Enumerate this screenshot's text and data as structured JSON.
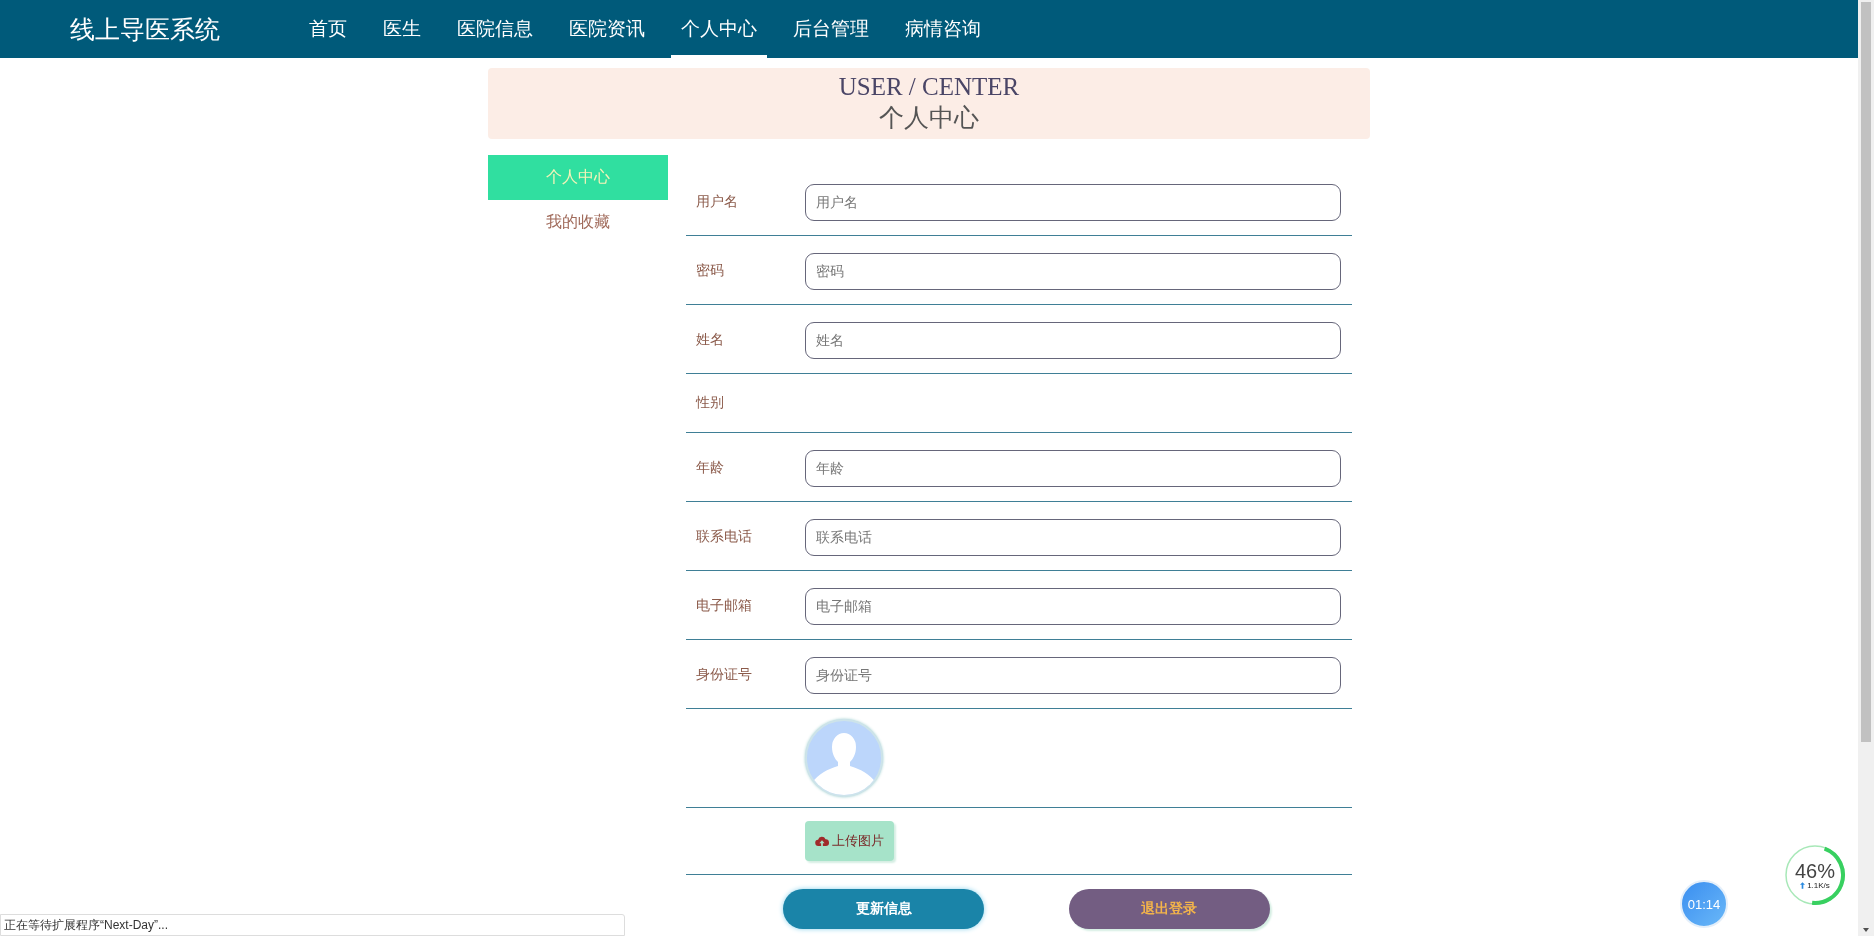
{
  "header": {
    "logo": "线上导医系统",
    "nav": [
      {
        "label": "首页",
        "selected": false
      },
      {
        "label": "医生",
        "selected": false
      },
      {
        "label": "医院信息",
        "selected": false
      },
      {
        "label": "医院资讯",
        "selected": false
      },
      {
        "label": "个人中心",
        "selected": true
      },
      {
        "label": "后台管理",
        "selected": false
      },
      {
        "label": "病情咨询",
        "selected": false
      }
    ]
  },
  "banner": {
    "title": "USER / CENTER",
    "subtitle": "个人中心"
  },
  "sidebar": {
    "items": [
      {
        "label": "个人中心",
        "selected": true
      },
      {
        "label": "我的收藏",
        "selected": false
      }
    ]
  },
  "form": {
    "rows": [
      {
        "kind": "input",
        "label": "用户名",
        "placeholder": "用户名"
      },
      {
        "kind": "input",
        "label": "密码",
        "placeholder": "密码"
      },
      {
        "kind": "input",
        "label": "姓名",
        "placeholder": "姓名"
      },
      {
        "kind": "blank",
        "label": "性别"
      },
      {
        "kind": "input",
        "label": "年龄",
        "placeholder": "年龄"
      },
      {
        "kind": "input",
        "label": "联系电话",
        "placeholder": "联系电话"
      },
      {
        "kind": "input",
        "label": "电子邮箱",
        "placeholder": "电子邮箱"
      },
      {
        "kind": "input",
        "label": "身份证号",
        "placeholder": "身份证号"
      },
      {
        "kind": "avatar"
      },
      {
        "kind": "upload",
        "button": "上传图片"
      }
    ]
  },
  "buttons": [
    {
      "kind": "primary",
      "label": "更新信息"
    },
    {
      "kind": "secondary",
      "label": "退出登录"
    }
  ],
  "status_bar": "正在等待扩展程序“Next-Day”...",
  "speed_widget": {
    "percent": "46%",
    "rate": "1.1K/s",
    "level": 0.46
  },
  "timer": "01:14"
}
